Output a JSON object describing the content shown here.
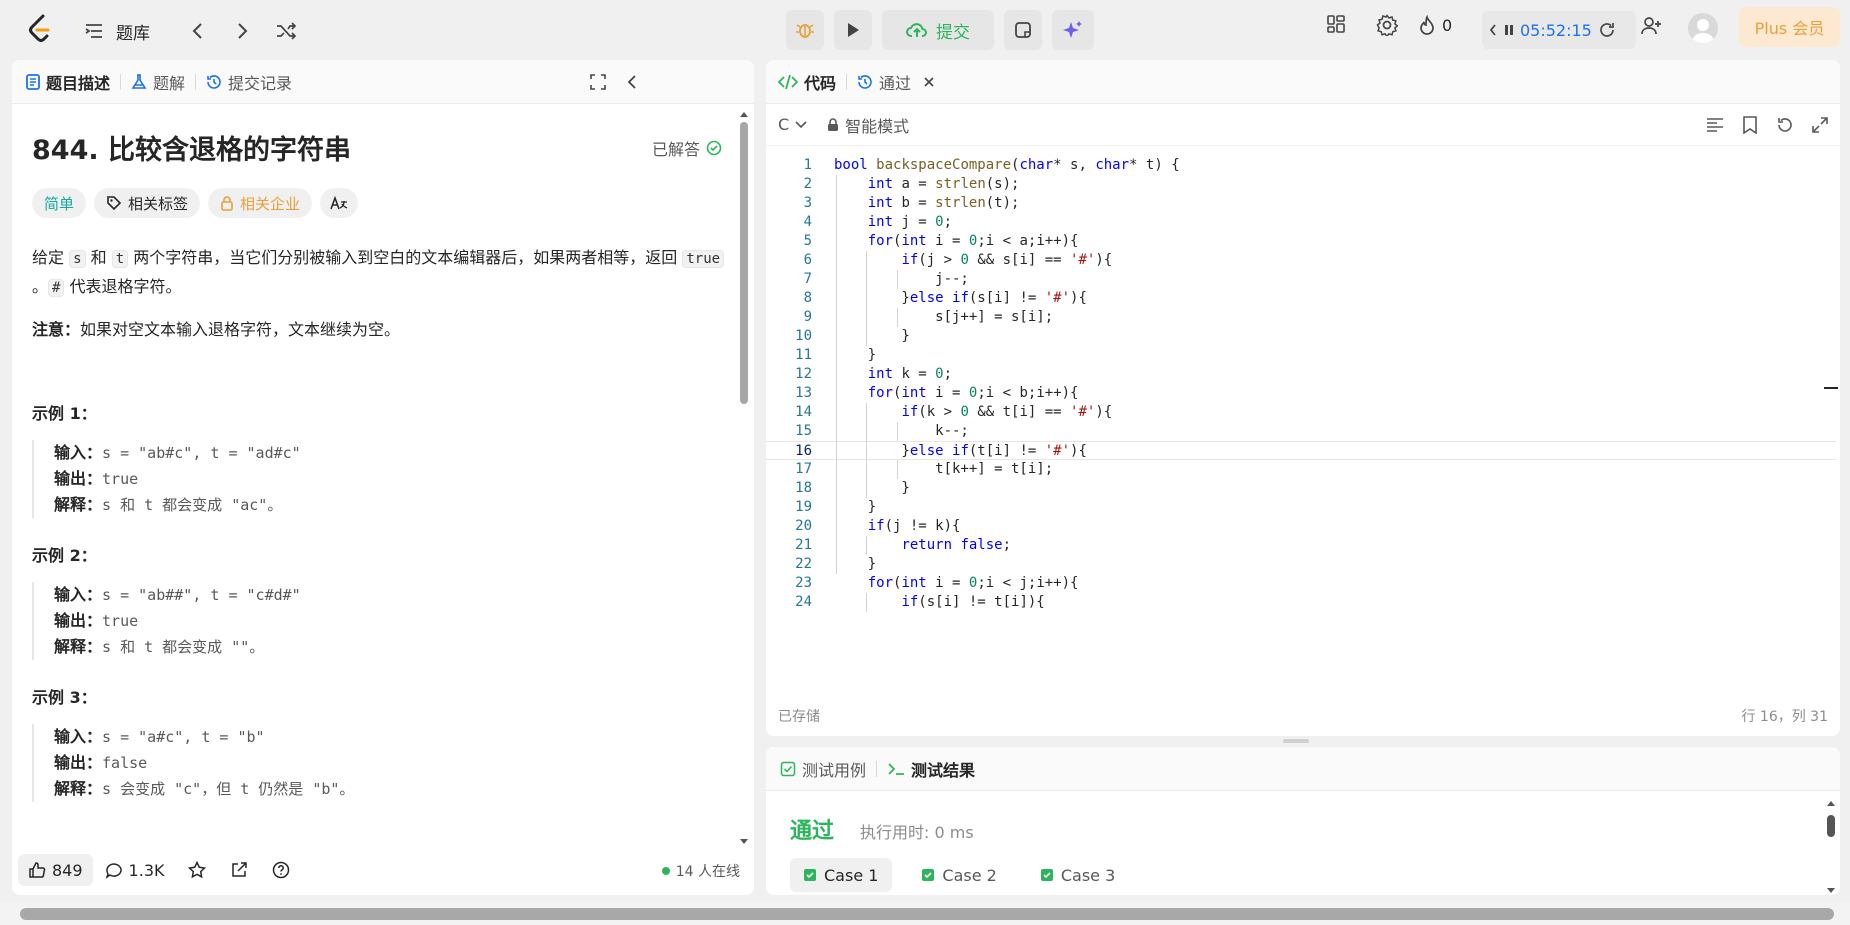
{
  "nav": {
    "title": "题库",
    "submit_label": "提交",
    "streak_count": "0",
    "timer": "05:52:15",
    "plus_label": "Plus 会员"
  },
  "left_tabs": [
    {
      "label": "题目描述"
    },
    {
      "label": "题解"
    },
    {
      "label": "提交记录"
    }
  ],
  "problem": {
    "title": "844. 比较含退格的字符串",
    "status": "已解答",
    "tags": {
      "difficulty": "简单",
      "related_tags": "相关标签",
      "companies": "相关企业"
    },
    "desc_p1_a": "给定 ",
    "desc_s": "s",
    "desc_p1_b": " 和 ",
    "desc_t": "t",
    "desc_p1_c": " 两个字符串，当它们分别被输入到空白的文本编辑器后，如果两者相等，返回 ",
    "desc_true": "true",
    "desc_p1_d": " 。",
    "desc_hash": "#",
    "desc_p1_e": " 代表退格字符。",
    "note_label": "注意：",
    "note_text": "如果对空文本输入退格字符，文本继续为空。",
    "examples": [
      {
        "title": "示例 1：",
        "input_label": "输入：",
        "input": "s = \"ab#c\", t = \"ad#c\"",
        "output_label": "输出：",
        "output": "true",
        "explain_label": "解释：",
        "explain": "s 和 t 都会变成 \"ac\"。"
      },
      {
        "title": "示例 2：",
        "input_label": "输入：",
        "input": "s = \"ab##\", t = \"c#d#\"",
        "output_label": "输出：",
        "output": "true",
        "explain_label": "解释：",
        "explain": "s 和 t 都会变成 \"\"。"
      },
      {
        "title": "示例 3：",
        "input_label": "输入：",
        "input": "s = \"a#c\", t = \"b\"",
        "output_label": "输出：",
        "output": "false",
        "explain_label": "解释：",
        "explain": "s 会变成 \"c\"，但 t 仍然是 \"b\"。"
      }
    ]
  },
  "footer": {
    "likes": "849",
    "comments": "1.3K",
    "online": "14 人在线"
  },
  "code_tabs": [
    {
      "label": "代码"
    },
    {
      "label": "通过"
    }
  ],
  "editor": {
    "language": "C",
    "mode": "智能模式",
    "saved": "已存储",
    "cursor": "行 16，列 31",
    "current_line": 16,
    "lines": [
      "bool backspaceCompare(char* s, char* t) {",
      "    int a = strlen(s);",
      "    int b = strlen(t);",
      "    int j = 0;",
      "    for(int i = 0;i < a;i++){",
      "        if(j > 0 && s[i] == '#'){",
      "            j--;",
      "        }else if(s[i] != '#'){",
      "            s[j++] = s[i];",
      "        }",
      "    }",
      "    int k = 0;",
      "    for(int i = 0;i < b;i++){",
      "        if(k > 0 && t[i] == '#'){",
      "            k--;",
      "        }else if(t[i] != '#'){",
      "            t[k++] = t[i];",
      "        }",
      "    }",
      "    if(j != k){",
      "        return false;",
      "    }",
      "    for(int i = 0;i < j;i++){",
      "        if(s[i] != t[i]){"
    ]
  },
  "test_tabs": [
    {
      "label": "测试用例"
    },
    {
      "label": "测试结果"
    }
  ],
  "result": {
    "status": "通过",
    "runtime": "执行用时: 0 ms",
    "cases": [
      "Case 1",
      "Case 2",
      "Case 3"
    ]
  },
  "colors": {
    "accent_green": "#2db55d",
    "accent_blue": "#1a73e8",
    "plus_orange": "#e8a03a"
  }
}
